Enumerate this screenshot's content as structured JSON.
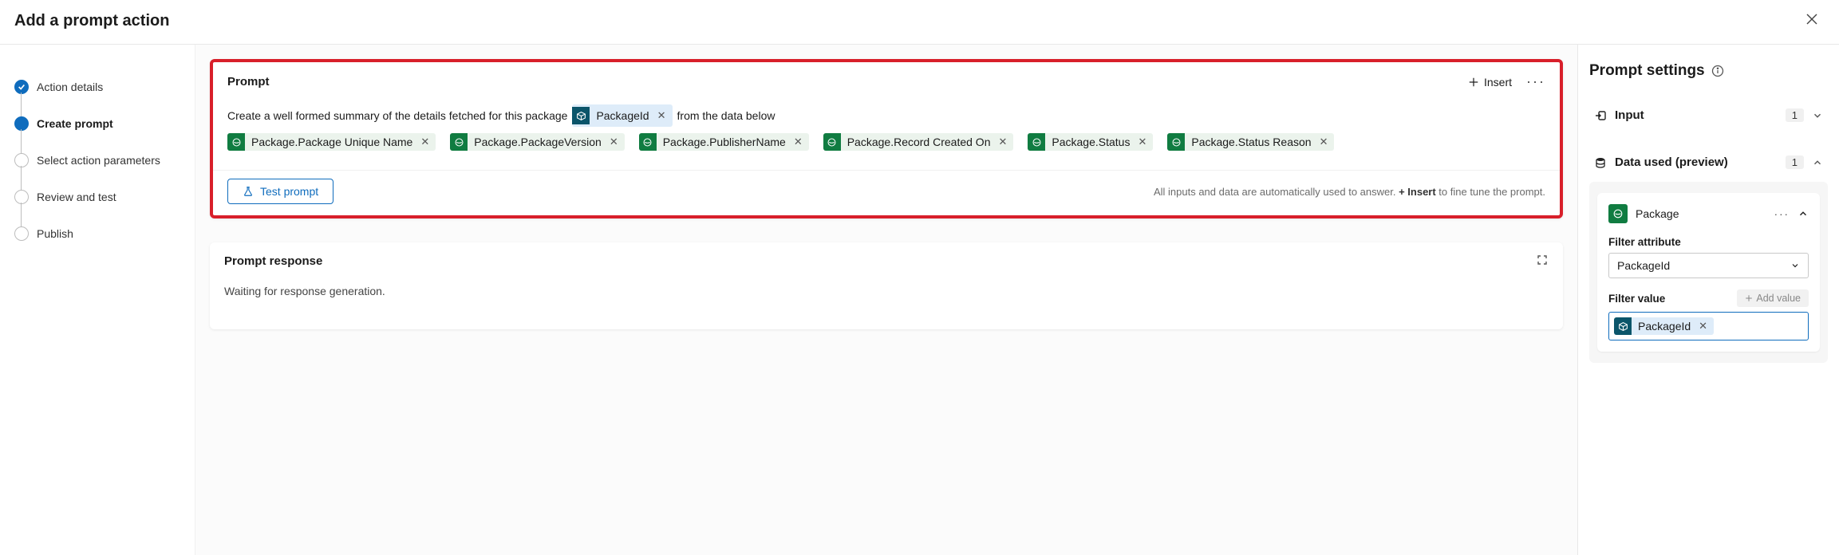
{
  "header": {
    "title": "Add a prompt action"
  },
  "steps": [
    {
      "label": "Action details",
      "state": "done"
    },
    {
      "label": "Create prompt",
      "state": "current"
    },
    {
      "label": "Select action parameters",
      "state": "pending"
    },
    {
      "label": "Review and test",
      "state": "pending"
    },
    {
      "label": "Publish",
      "state": "pending"
    }
  ],
  "prompt": {
    "title": "Prompt",
    "insert_label": "Insert",
    "text_before": "Create a well formed summary of the details fetched for this package",
    "inline_chip": "PackageId",
    "text_after": "from the data below",
    "chips": [
      "Package.Package Unique Name",
      "Package.PackageVersion",
      "Package.PublisherName",
      "Package.Record Created On",
      "Package.Status",
      "Package.Status Reason"
    ],
    "test_label": "Test prompt",
    "hint_prefix": "All inputs and data are automatically used to answer. ",
    "hint_bold": "+ Insert",
    "hint_suffix": " to fine tune the prompt."
  },
  "response": {
    "title": "Prompt response",
    "body": "Waiting for response generation."
  },
  "right": {
    "title": "Prompt settings",
    "input": {
      "label": "Input",
      "count": "1"
    },
    "data_used": {
      "label": "Data used (preview)",
      "count": "1"
    },
    "entity": {
      "name": "Package",
      "filter_attr_label": "Filter attribute",
      "filter_attr_value": "PackageId",
      "filter_value_label": "Filter value",
      "add_value_label": "Add value",
      "filter_value_chip": "PackageId"
    }
  }
}
